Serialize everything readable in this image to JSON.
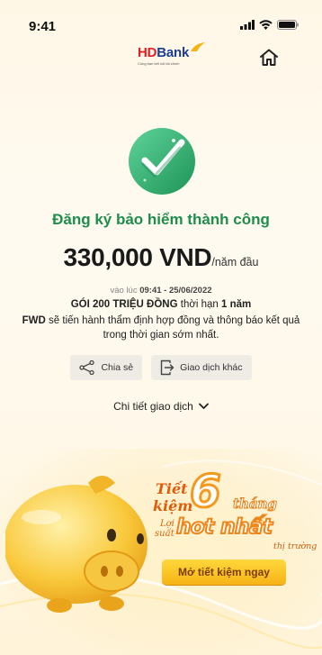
{
  "status_bar": {
    "time": "9:41"
  },
  "header": {
    "logo_hd": "HD",
    "logo_bank": "Bank",
    "logo_tagline": "Cùng bạn kết nối tài chính"
  },
  "result": {
    "title": "Đăng ký bảo hiểm thành công",
    "amount": "330,000 VND",
    "period": "/năm đầu",
    "time_prefix": "vào lúc",
    "time_value": "09:41 - 25/06/2022",
    "package_name": "GÓI 200 TRIỆU ĐỒNG",
    "package_mid": " thời hạn ",
    "package_term": "1 năm",
    "desc_company": "FWD",
    "desc_text": " sẽ tiến hành thẩm định hợp đồng và thông báo kết quả trong thời gian sớm nhất."
  },
  "actions": {
    "share_label": "Chia sẻ",
    "other_label": "Giao dịch khác"
  },
  "details": {
    "label": "Chi tiết giao dịch"
  },
  "banner": {
    "tiet": "Tiết",
    "kiem": "kiệm",
    "six": "6",
    "thang": "tháng",
    "loi": "Lợi",
    "suat": "suất",
    "hot": "hot nhất",
    "market": "thị trường",
    "cta_label": "Mở tiết kiệm ngay"
  },
  "icons": {
    "home": "home-icon",
    "check": "check-icon",
    "share": "share-icon",
    "transaction": "transaction-icon",
    "chevron": "chevron-down-icon"
  },
  "colors": {
    "success_green": "#1e8e4c",
    "brand_red": "#e31e24",
    "brand_blue": "#1a3d8f",
    "cta_yellow": "#f6b316"
  }
}
